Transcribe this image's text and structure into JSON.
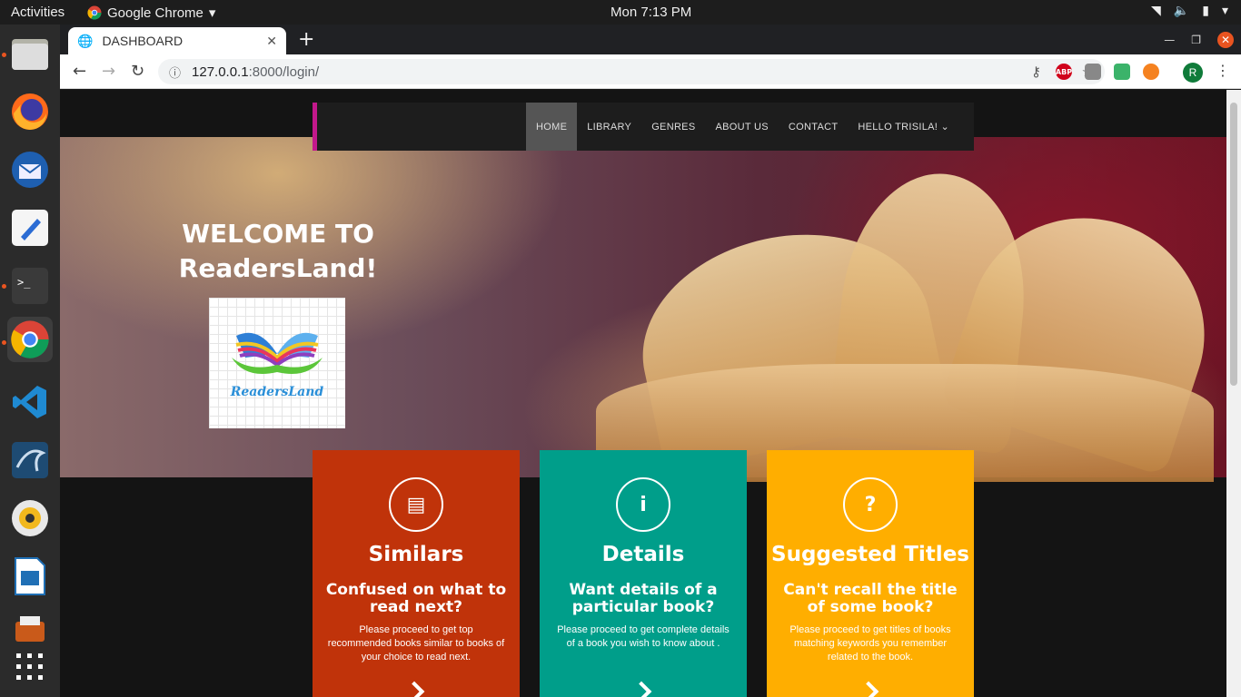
{
  "system": {
    "activities": "Activities",
    "app_name": "Google Chrome",
    "clock": "Mon  7:13 PM"
  },
  "browser": {
    "tab_title": "DASHBOARD",
    "url_host": "127.0.0.1",
    "url_path": ":8000/login/",
    "profile_initial": "R",
    "ext_abp": "ABP"
  },
  "nav": {
    "items": [
      "HOME",
      "LIBRARY",
      "GENRES",
      "ABOUT US",
      "CONTACT",
      "HELLO TRISILA! ⌄"
    ]
  },
  "hero": {
    "welcome_line1": "WELCOME TO",
    "welcome_line2": "ReadersLand!",
    "logo_text": "ReadersLand"
  },
  "cards": [
    {
      "icon": "▤",
      "title": "Similars",
      "subtitle": "Confused on what to read next?",
      "text": "Please proceed to get top recommended books similar to books of your choice to read next.",
      "color": "#c0330a"
    },
    {
      "icon": "i",
      "title": "Details",
      "subtitle": "Want details of a particular book?",
      "text": "Please proceed to get complete details of a book you wish to know about .",
      "color": "#009e8a"
    },
    {
      "icon": "?",
      "title": "Suggested Titles",
      "subtitle": "Can't recall the title of some book?",
      "text": "Please proceed to get titles of books matching keywords you remember related to the book.",
      "color": "#ffae00"
    }
  ]
}
